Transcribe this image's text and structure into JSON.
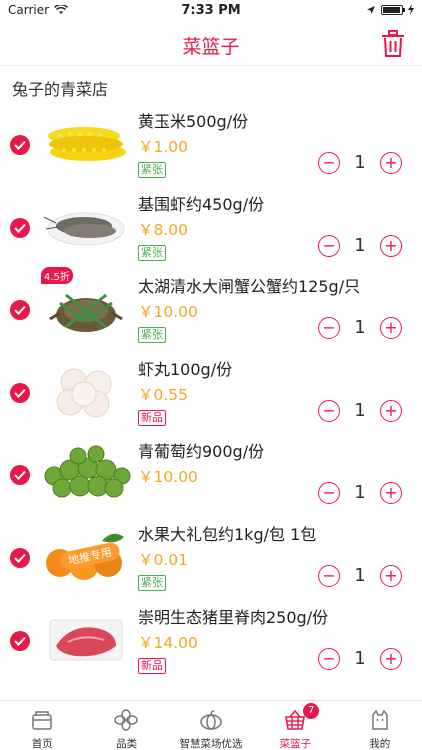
{
  "status": {
    "carrier": "Carrier",
    "time": "7:33 PM"
  },
  "header": {
    "title": "菜篮子"
  },
  "store": {
    "name": "兔子的青菜店"
  },
  "items": [
    {
      "name": "黄玉米500g/份",
      "price": "￥1.00",
      "tag": "紧张",
      "tag_color": "#4caf50",
      "qty": "1",
      "image": "corn"
    },
    {
      "name": "基围虾约450g/份",
      "price": "￥8.00",
      "tag": "紧张",
      "tag_color": "#4caf50",
      "qty": "1",
      "image": "shrimp"
    },
    {
      "name": "太湖清水大闸蟹公蟹约125g/只",
      "price": "￥10.00",
      "tag": "紧张",
      "tag_color": "#4caf50",
      "qty": "1",
      "image": "crab",
      "discount": "4.5折"
    },
    {
      "name": "虾丸100g/份",
      "price": "￥0.55",
      "tag": "新品",
      "tag_color": "#e8194a",
      "qty": "1",
      "image": "shrimp-balls"
    },
    {
      "name": "青葡萄约900g/份",
      "price": "￥10.00",
      "tag": "",
      "tag_color": "",
      "qty": "1",
      "image": "grapes"
    },
    {
      "name": "水果大礼包约1kg/包  1包",
      "price": "￥0.01",
      "tag": "紧张",
      "tag_color": "#4caf50",
      "qty": "1",
      "image": "fruit-pack",
      "image_text": "地推专用"
    },
    {
      "name": "崇明生态猪里脊肉250g/份",
      "price": "￥14.00",
      "tag": "新品",
      "tag_color": "#e8194a",
      "qty": "1",
      "image": "pork"
    }
  ],
  "stepper": {
    "minus": "−",
    "plus": "+"
  },
  "tabs": [
    {
      "label": "首页",
      "icon": "home-icon"
    },
    {
      "label": "品类",
      "icon": "category-icon"
    },
    {
      "label": "智慧菜场优选",
      "icon": "pumpkin-icon"
    },
    {
      "label": "菜篮子",
      "icon": "basket-icon",
      "active": true,
      "badge": "7"
    },
    {
      "label": "我的",
      "icon": "cat-icon"
    }
  ],
  "colors": {
    "accent": "#e8194a",
    "price": "#f5a623",
    "green": "#4caf50"
  }
}
